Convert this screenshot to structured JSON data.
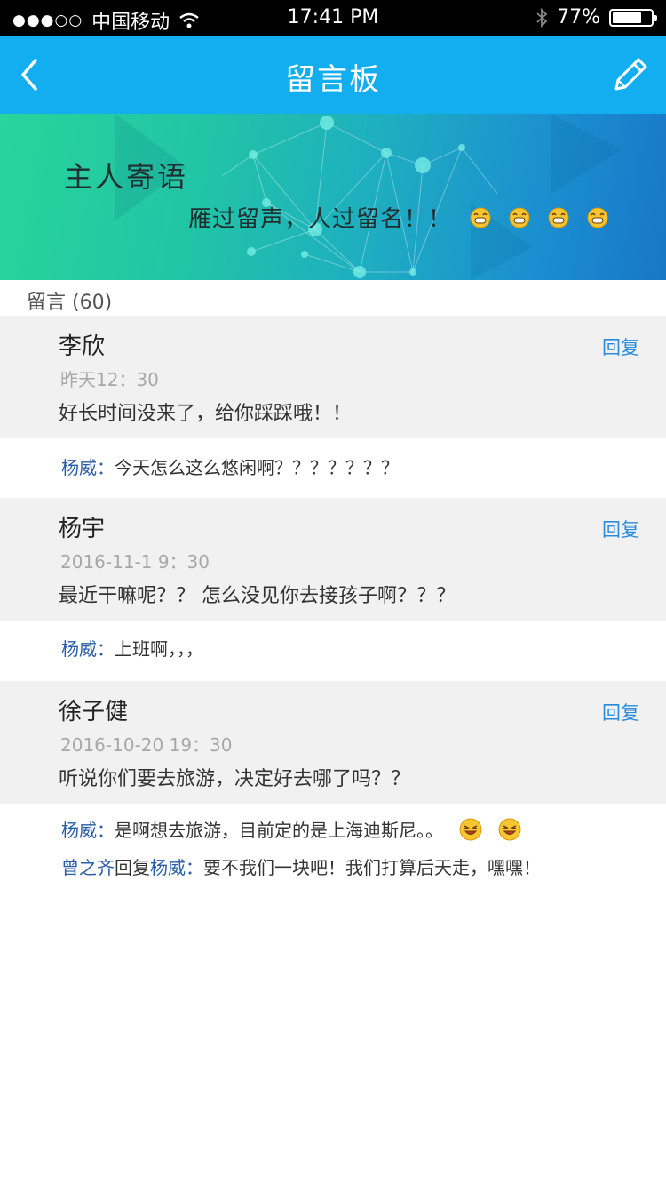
{
  "status_bar": {
    "signal": "●●●○○",
    "carrier": "中国移动",
    "time": "17:41 PM",
    "battery_text": "77%",
    "battery_level": 0.77
  },
  "nav": {
    "title": "留言板",
    "back_icon": "chevron-left-icon",
    "edit_icon": "pencil-icon"
  },
  "banner": {
    "title": "主人寄语",
    "motto": "雁过留声，人过留名！！"
  },
  "count_label": "留言 (60)",
  "messages": [
    {
      "name": "李欣",
      "time": "昨天12：30",
      "text": "好长时间没来了，给你踩踩哦！！",
      "reply_label": "回复",
      "replies": [
        {
          "user": "杨威",
          "sep": "：",
          "text": "今天怎么这么悠闲啊？？？？？？？"
        }
      ]
    },
    {
      "name": "杨宇",
      "time": "2016-11-1  9：30",
      "text": "最近干嘛呢？？ 怎么没见你去接孩子啊？？？",
      "reply_label": "回复",
      "replies": [
        {
          "user": "杨威",
          "sep": "：",
          "text": "上班啊，，，"
        }
      ]
    },
    {
      "name": "徐子健",
      "time": "2016-10-20   19：30",
      "text": "听说你们要去旅游，决定好去哪了吗？？",
      "reply_label": "回复",
      "replies": [
        {
          "user": "杨威",
          "sep": "：",
          "text": "是啊想去旅游，目前定的是上海迪斯尼。。"
        },
        {
          "user": "曾之齐",
          "mid": "回复",
          "user2": "杨威",
          "sep": "：",
          "text": "要不我们一块吧！我们打算后天走，嘿嘿！"
        }
      ]
    }
  ]
}
